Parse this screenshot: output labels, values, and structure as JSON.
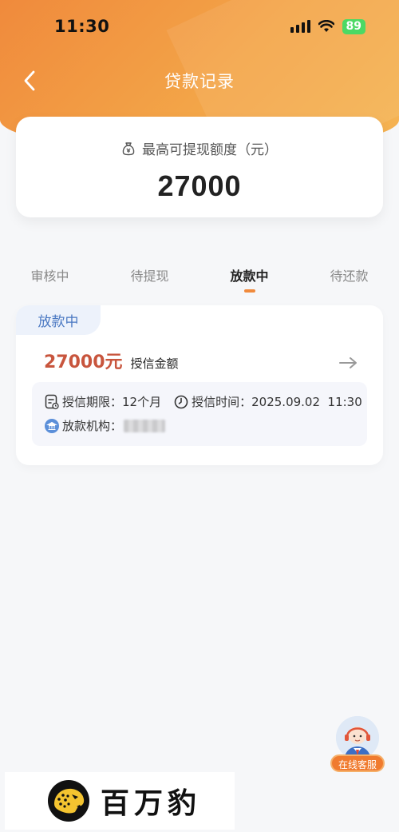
{
  "status_bar": {
    "time": "11:30",
    "battery": "89"
  },
  "nav": {
    "title": "贷款记录"
  },
  "quota": {
    "label": "最高可提现额度（元）",
    "value": "27000"
  },
  "tabs": [
    {
      "label": "审核中"
    },
    {
      "label": "待提现"
    },
    {
      "label": "放款中",
      "active": true
    },
    {
      "label": "待还款"
    }
  ],
  "record": {
    "status": "放款中",
    "amount": "27000元",
    "amount_label": "授信金额",
    "term_label": "授信期限：",
    "term_value": "12个月",
    "time_label": "授信时间：",
    "time_value": "2025.09.02  11:30",
    "institution_label": "放款机构："
  },
  "service": {
    "label": "在线客服"
  },
  "brand": {
    "name": "百万豹"
  },
  "colors": {
    "accent": "#f08a3c",
    "amount": "#c8553d",
    "tag": "#4a78c2"
  }
}
